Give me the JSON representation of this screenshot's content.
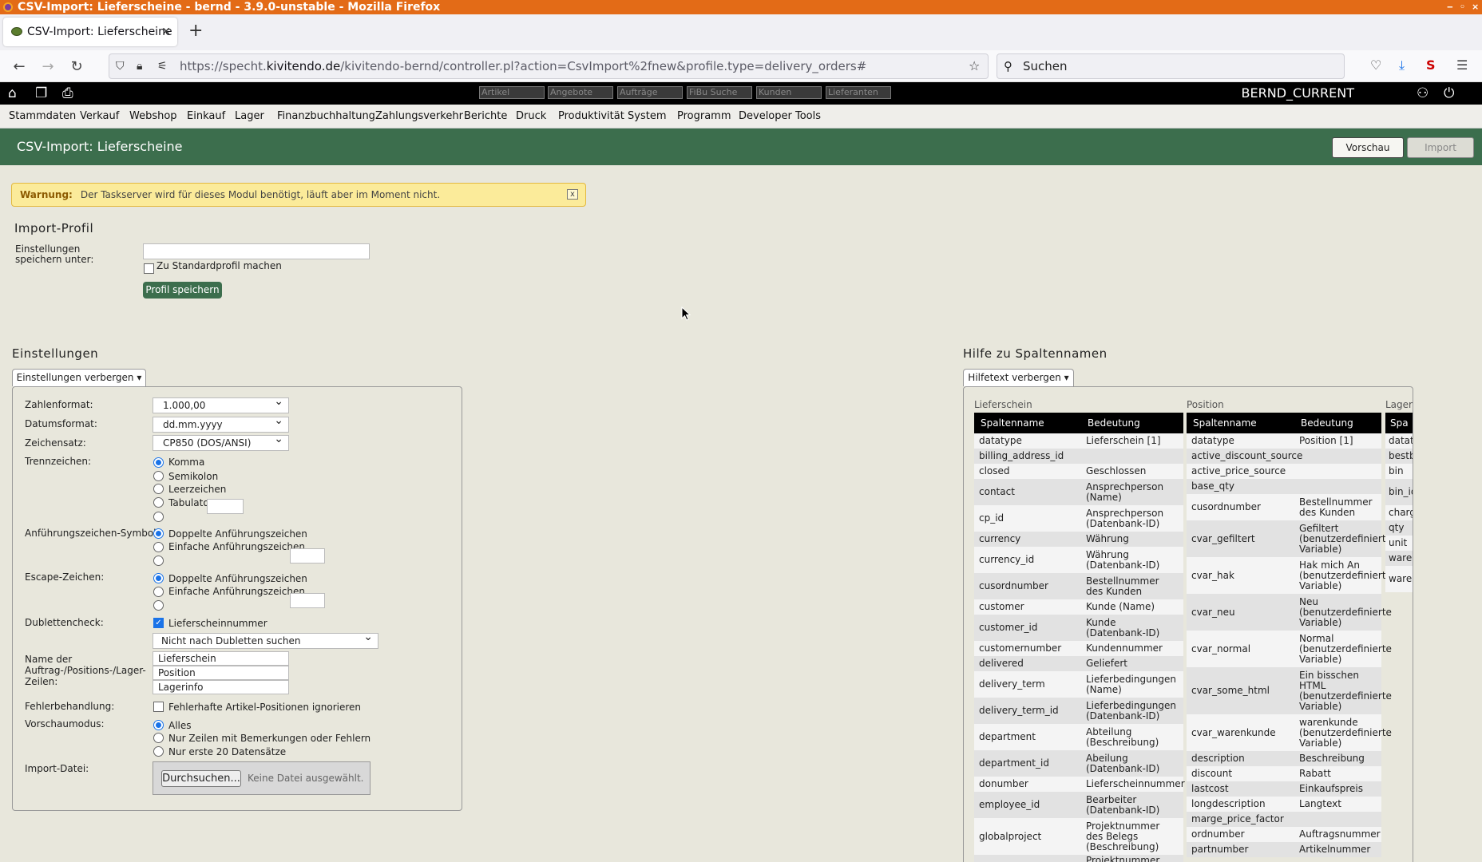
{
  "window": {
    "title": "CSV-Import: Lieferscheine - bernd - 3.9.0-unstable - Mozilla Firefox"
  },
  "tab": {
    "label": "CSV-Import: Lieferscheine"
  },
  "url": {
    "prefix": "https://specht.",
    "domain": "kivitendo.de",
    "path": "/kivitendo-bernd/controller.pl?action=CsvImport%2fnew&profile.type=delivery_orders#"
  },
  "search": {
    "placeholder": "Suchen"
  },
  "topbar": {
    "quicksearch": [
      "Artikel",
      "Angebote",
      "Aufträge",
      "FiBu Suche",
      "Kunden",
      "Lieferanten"
    ],
    "user": "BERND_CURRENT"
  },
  "menu": [
    "Stammdaten",
    "Verkauf",
    "Webshop",
    "Einkauf",
    "Lager",
    "Finanzbuchhaltung",
    "Zahlungsverkehr",
    "Berichte",
    "Druck",
    "Produktivität",
    "System",
    "Programm",
    "Developer Tools"
  ],
  "header": {
    "title": "CSV-Import: Lieferscheine",
    "preview_label": "Vorschau",
    "import_label": "Import"
  },
  "warning": {
    "label": "Warnung:",
    "text": "Der Taskserver wird für dieses Modul benötigt, läuft aber im Moment nicht.",
    "close": "x"
  },
  "profile": {
    "heading": "Import-Profil",
    "save_under_label": "Einstellungen speichern unter:",
    "save_under_value": "",
    "default_label": "Zu Standardprofil machen",
    "save_button": "Profil speichern"
  },
  "settings": {
    "heading": "Einstellungen",
    "tab_label": "Einstellungen verbergen ▾",
    "number_format_label": "Zahlenformat:",
    "number_format": "1.000,00",
    "date_format_label": "Datumsformat:",
    "date_format": "dd.mm.yyyy",
    "charset_label": "Zeichensatz:",
    "charset": "CP850 (DOS/ANSI)",
    "sep_label": "Trennzeichen:",
    "sep_options": [
      "Komma",
      "Semikolon",
      "Leerzeichen",
      "Tabulator"
    ],
    "quote_label": "Anführungszeichen-Symbol:",
    "quote_options": [
      "Doppelte Anführungszeichen",
      "Einfache Anführungszeichen"
    ],
    "escape_label": "Escape-Zeichen:",
    "escape_options": [
      "Doppelte Anführungszeichen",
      "Einfache Anführungszeichen"
    ],
    "dup_label": "Dublettencheck:",
    "dup_check": "Lieferscheinnummer",
    "dup_mode": "Nicht nach Dubletten suchen",
    "rowname_label": "Name der Auftrag-/Positions-/Lager-Zeilen:",
    "rownames": [
      "Lieferschein",
      "Position",
      "Lagerinfo"
    ],
    "error_label": "Fehlerbehandlung:",
    "error_option": "Fehlerhafte Artikel-Positionen ignorieren",
    "preview_label": "Vorschaumodus:",
    "preview_options": [
      "Alles",
      "Nur Zeilen mit Bemerkungen oder Fehlern",
      "Nur erste 20 Datensätze"
    ],
    "file_label": "Import-Datei:",
    "browse_button": "Durchsuchen...",
    "no_file": "Keine Datei ausgewählt."
  },
  "help": {
    "heading": "Hilfe zu Spaltennamen",
    "tab_label": "Hilfetext verbergen ▾",
    "col_name": "Spaltenname",
    "col_meaning": "Bedeutung",
    "sections": [
      "Lieferschein",
      "Position",
      "Lageri"
    ],
    "lieferschein": [
      [
        "datatype",
        "Lieferschein [1]"
      ],
      [
        "billing_address_id",
        ""
      ],
      [
        "closed",
        "Geschlossen"
      ],
      [
        "contact",
        "Ansprechperson (Name)"
      ],
      [
        "cp_id",
        "Ansprechperson (Datenbank-ID)"
      ],
      [
        "currency",
        "Währung"
      ],
      [
        "currency_id",
        "Währung (Datenbank-ID)"
      ],
      [
        "cusordnumber",
        "Bestellnummer des Kunden"
      ],
      [
        "customer",
        "Kunde (Name)"
      ],
      [
        "customer_id",
        "Kunde (Datenbank-ID)"
      ],
      [
        "customernumber",
        "Kundennummer"
      ],
      [
        "delivered",
        "Geliefert"
      ],
      [
        "delivery_term",
        "Lieferbedingungen (Name)"
      ],
      [
        "delivery_term_id",
        "Lieferbedingungen (Datenbank-ID)"
      ],
      [
        "department",
        "Abteilung (Beschreibung)"
      ],
      [
        "department_id",
        "Abeilung (Datenbank-ID)"
      ],
      [
        "donumber",
        "Lieferscheinnummer"
      ],
      [
        "employee_id",
        "Bearbeiter (Datenbank-ID)"
      ],
      [
        "globalproject",
        "Projektnummer des Belegs (Beschreibung)"
      ],
      [
        "",
        "Projektnummer des"
      ]
    ],
    "position": [
      [
        "datatype",
        "Position [1]"
      ],
      [
        "active_discount_source",
        ""
      ],
      [
        "active_price_source",
        ""
      ],
      [
        "base_qty",
        ""
      ],
      [
        "cusordnumber",
        "Bestellnummer des Kunden"
      ],
      [
        "cvar_gefiltert",
        "Gefiltert (benutzerdefinierte Variable)"
      ],
      [
        "cvar_hak",
        "Hak mich An (benutzerdefinierte Variable)"
      ],
      [
        "cvar_neu",
        "Neu (benutzerdefinierte Variable)"
      ],
      [
        "cvar_normal",
        "Normal (benutzerdefinierte Variable)"
      ],
      [
        "cvar_some_html",
        "Ein bisschen HTML (benutzerdefinierte Variable)"
      ],
      [
        "cvar_warenkunde",
        "warenkunde (benutzerdefinierte Variable)"
      ],
      [
        "description",
        "Beschreibung"
      ],
      [
        "discount",
        "Rabatt"
      ],
      [
        "lastcost",
        "Einkaufspreis"
      ],
      [
        "longdescription",
        "Langtext"
      ],
      [
        "marge_price_factor",
        ""
      ],
      [
        "ordnumber",
        "Auftragsnummer"
      ],
      [
        "partnumber",
        "Artikelnummer"
      ]
    ],
    "lager_header": "Spa",
    "lager": [
      "dataty",
      "bestb",
      "bin",
      "bin_id",
      "charg",
      "qty",
      "unit",
      "wareh",
      "wareh"
    ]
  }
}
